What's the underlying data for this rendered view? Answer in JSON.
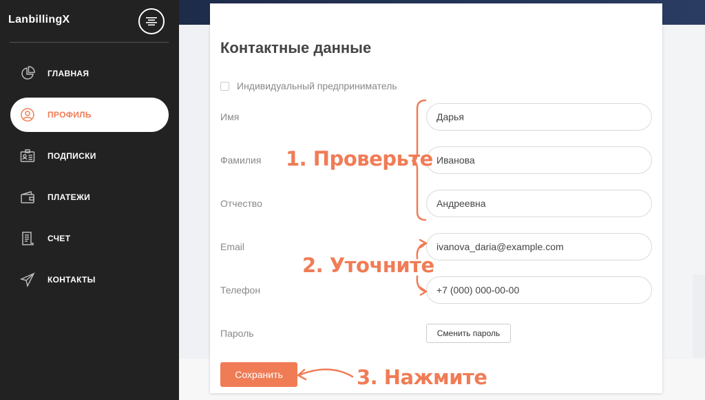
{
  "sidebar": {
    "brand": "LanbillingX",
    "items": [
      {
        "label": "ГЛАВНАЯ",
        "icon": "pie-chart-icon"
      },
      {
        "label": "ПРОФИЛЬ",
        "icon": "user-circle-icon"
      },
      {
        "label": "ПОДПИСКИ",
        "icon": "id-card-icon"
      },
      {
        "label": "ПЛАТЕЖИ",
        "icon": "wallet-icon"
      },
      {
        "label": "СЧЕТ",
        "icon": "receipt-icon"
      },
      {
        "label": "КОНТАКТЫ",
        "icon": "paper-plane-icon"
      }
    ],
    "active_index": 1
  },
  "card": {
    "title": "Контактные данные",
    "entrepreneur_label": "Индивидуальный предприниматель",
    "fields": {
      "first_name": {
        "label": "Имя",
        "value": "Дарья"
      },
      "last_name": {
        "label": "Фамилия",
        "value": "Иванова"
      },
      "middle_name": {
        "label": "Отчество",
        "value": "Андреевна"
      },
      "email": {
        "label": "Email",
        "value": "ivanova_daria@example.com"
      },
      "phone": {
        "label": "Телефон",
        "value": "+7 (000) 000-00-00"
      },
      "password": {
        "label": "Пароль",
        "button": "Сменить пароль"
      }
    },
    "save_label": "Сохранить"
  },
  "annotations": {
    "step1": "1. Проверьте",
    "step2": "2. Уточните",
    "step3": "3. Нажмите"
  },
  "colors": {
    "accent": "#f07c56",
    "sidebar_bg": "#222222"
  }
}
